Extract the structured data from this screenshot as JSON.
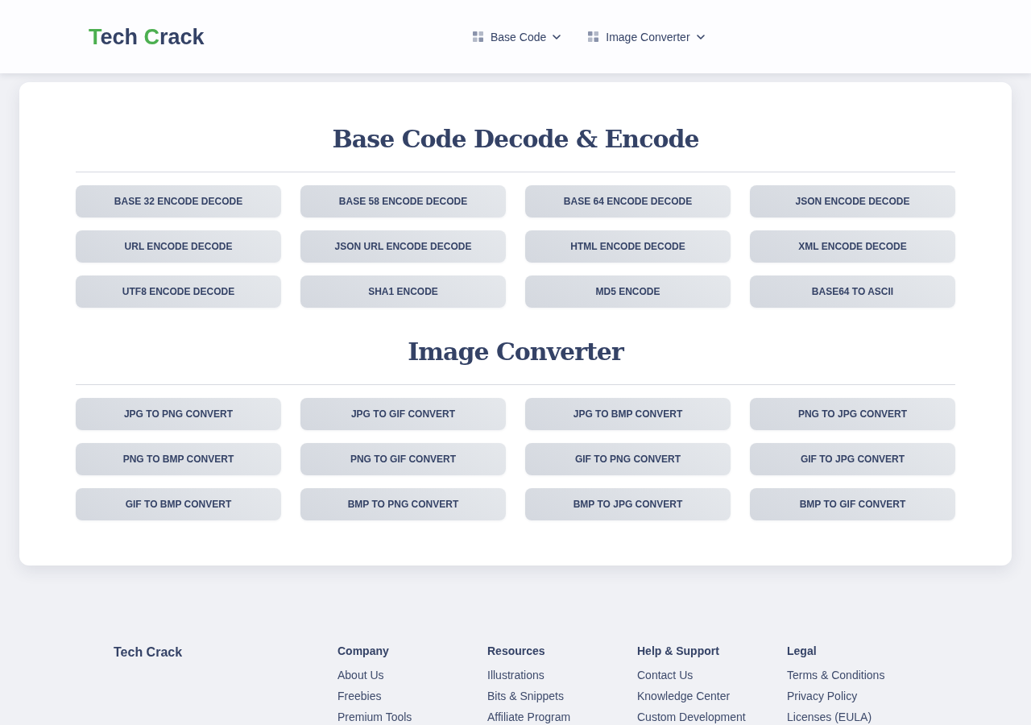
{
  "header": {
    "logo": [
      {
        "text": "T",
        "accent": true
      },
      {
        "text": "ech ",
        "accent": false
      },
      {
        "text": "C",
        "accent": true
      },
      {
        "text": "rack",
        "accent": false
      }
    ],
    "nav": [
      {
        "label": "Base Code"
      },
      {
        "label": "Image Converter"
      }
    ]
  },
  "sections": [
    {
      "title": "Base Code Decode & Encode",
      "buttons": [
        "BASE 32 ENCODE DECODE",
        "BASE 58 ENCODE DECODE",
        "BASE 64 ENCODE DECODE",
        "JSON ENCODE DECODE",
        "URL ENCODE DECODE",
        "JSON URL ENCODE DECODE",
        "HTML ENCODE DECODE",
        "XML ENCODE DECODE",
        "UTF8 ENCODE DECODE",
        "SHA1 ENCODE",
        "MD5 ENCODE",
        "BASE64 TO ASCII"
      ]
    },
    {
      "title": "Image Converter",
      "buttons": [
        "JPG TO PNG CONVERT",
        "JPG TO GIF CONVERT",
        "JPG TO BMP CONVERT",
        "PNG TO JPG CONVERT",
        "PNG TO BMP CONVERT",
        "PNG TO GIF CONVERT",
        "GIF TO PNG CONVERT",
        "GIF TO JPG CONVERT",
        "GIF TO BMP CONVERT",
        "BMP TO PNG CONVERT",
        "BMP TO JPG CONVERT",
        "BMP TO GIF CONVERT"
      ]
    }
  ],
  "footer": {
    "brand": "Tech Crack",
    "columns": [
      {
        "heading": "Company",
        "links": [
          "About Us",
          "Freebies",
          "Premium Tools"
        ]
      },
      {
        "heading": "Resources",
        "links": [
          "Illustrations",
          "Bits & Snippets",
          "Affiliate Program"
        ]
      },
      {
        "heading": "Help & Support",
        "links": [
          "Contact Us",
          "Knowledge Center",
          "Custom Development"
        ]
      },
      {
        "heading": "Legal",
        "links": [
          "Terms & Conditions",
          "Privacy Policy",
          "Licenses (EULA)"
        ]
      }
    ]
  }
}
